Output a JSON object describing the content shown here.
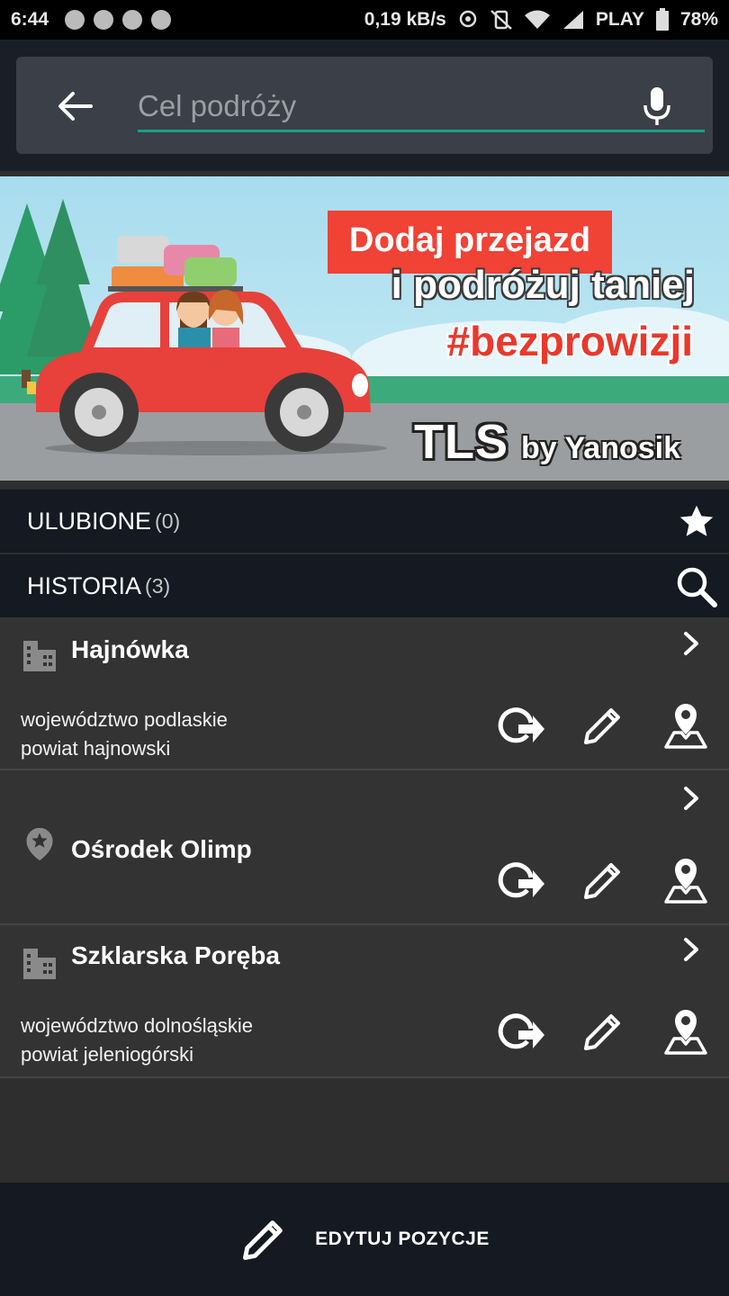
{
  "status_bar": {
    "time": "6:44",
    "network_speed": "0,19 kB/s",
    "carrier": "PLAY",
    "battery": "78%"
  },
  "search": {
    "placeholder": "Cel podróży",
    "value": ""
  },
  "banner": {
    "line1": "Dodaj przejazd",
    "line2": "i podróżuj taniej",
    "line3": "#bezprowizji",
    "brand": "TLS",
    "brand_suffix": "by Yanosik"
  },
  "favorites": {
    "title": "ULUBIONE",
    "count": "(0)"
  },
  "history": {
    "title": "HISTORIA",
    "count": "(3)",
    "items": [
      {
        "name": "Hajnówka",
        "type": "city-icon",
        "region_line1": "województwo podlaskie",
        "region_line2": "powiat hajnowski"
      },
      {
        "name": "Ośrodek Olimp",
        "type": "poi-pin-icon",
        "region_line1": "",
        "region_line2": ""
      },
      {
        "name": "Szklarska Poręba",
        "type": "city-icon",
        "region_line1": "województwo dolnośląskie",
        "region_line2": "powiat jeleniogórski"
      }
    ]
  },
  "bottom_bar": {
    "edit_label": "EDYTUJ POZYCJE"
  },
  "colors": {
    "accent": "#1a9e8c",
    "header_bg": "#141922",
    "list_bg": "#333333",
    "banner_red": "#f04235"
  }
}
